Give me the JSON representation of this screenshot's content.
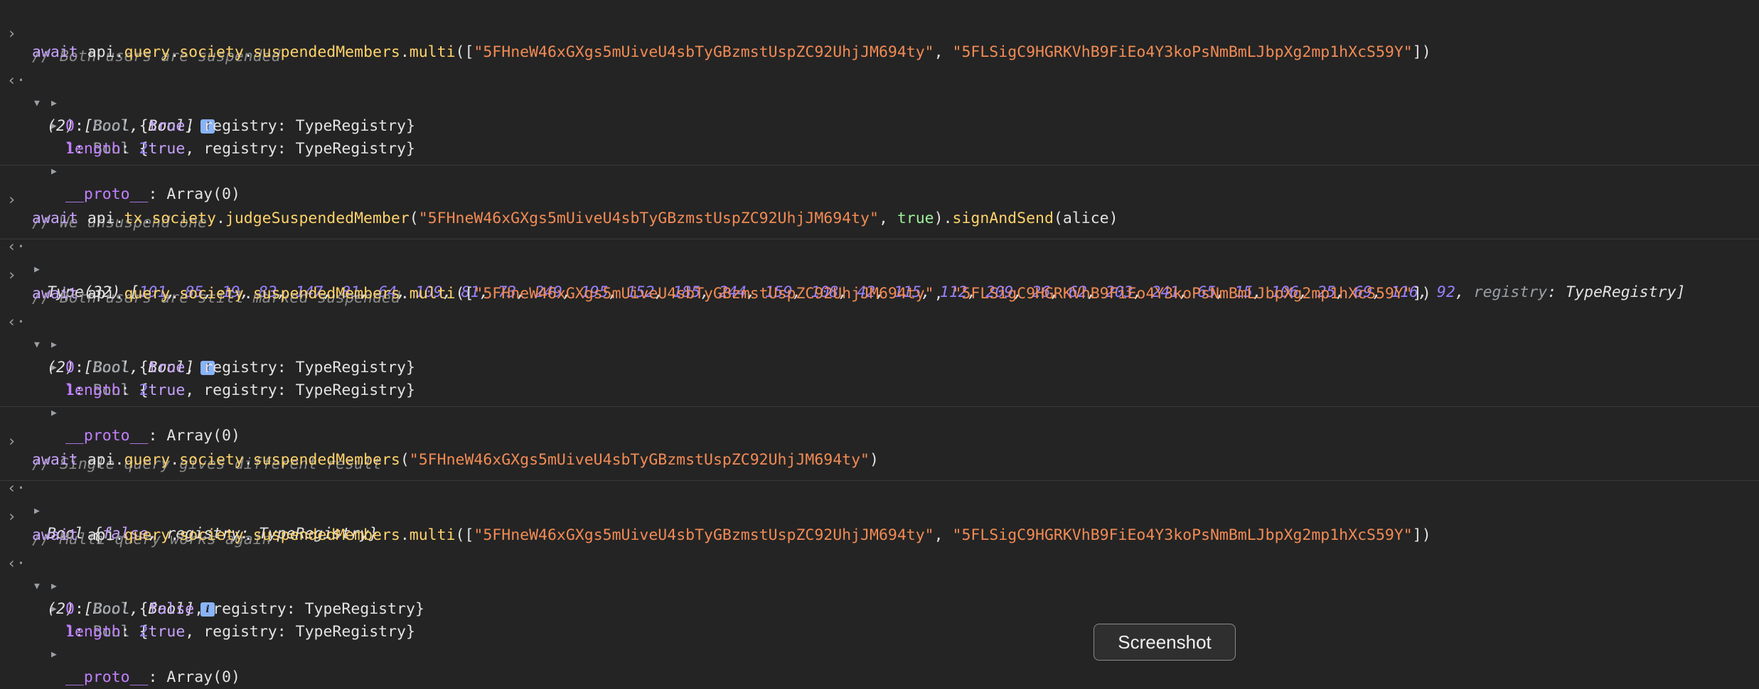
{
  "console": {
    "prompt_glyph": "›",
    "result_glyph": "‹·",
    "expanded_glyph": "▼",
    "collapsed_glyph": "▶",
    "info_glyph": "i",
    "comments": [
      "// Both users are suspended",
      "// We unsuspend one",
      "// Both users are still marked suspended",
      "// Single query gives different result",
      "// Multi-query works again"
    ],
    "tokens": {
      "await": "await",
      "api": "api",
      "query": "query",
      "society": "society",
      "tx": "tx",
      "suspendedMembers": "suspendedMembers",
      "multi": "multi",
      "judge": "judgeSuspendedMember",
      "signAndSend": "signAndSend",
      "alice": "alice",
      "true": "true",
      "false": "false",
      "registry": "registry",
      "TypeRegistry": "TypeRegistry",
      "Bool": "Bool",
      "length": "length",
      "proto": "__proto__",
      "array0": "Array(0)",
      "two": "2",
      "zero": "0",
      "one": "1",
      "summary": "(2) [Bool, Bool]",
      "type32": "Type(32)"
    },
    "addresses": {
      "a": "\"5FHneW46xGXgs5mUiveU4sbTyGBzmstUspZC92UhjJM694ty\"",
      "b": "\"5FLSigC9HGRKVhB9FiEo4Y3koPsNmBmLJbpXg2mp1hXcS59Y\""
    },
    "type32_values": [
      101,
      85,
      19,
      83,
      147,
      81,
      64,
      109,
      81,
      73,
      249,
      195,
      152,
      185,
      244,
      159,
      108,
      42,
      115,
      112,
      209,
      26,
      62,
      203,
      241,
      65,
      15,
      106,
      25,
      69,
      116,
      92
    ]
  },
  "tooltip": {
    "label": "Screenshot"
  }
}
